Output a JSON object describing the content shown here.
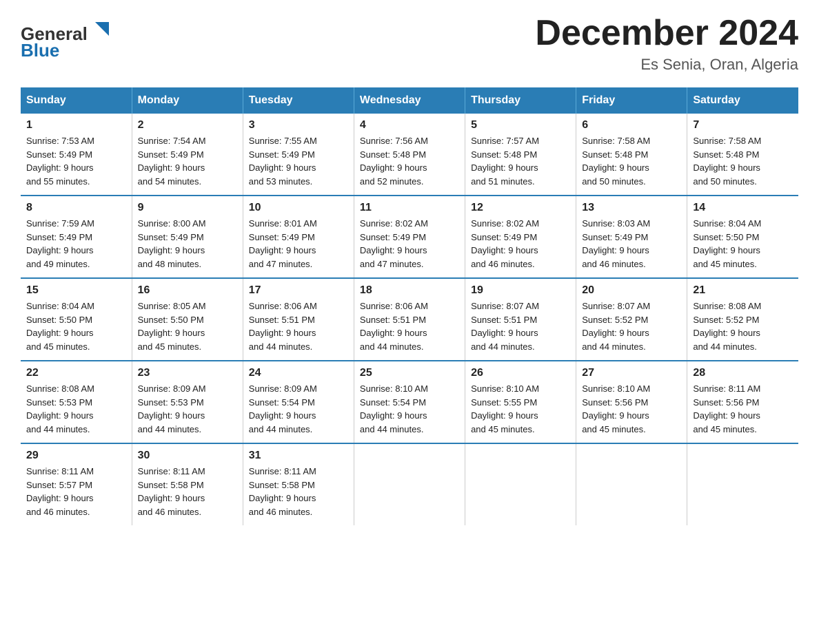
{
  "header": {
    "logo_text_general": "General",
    "logo_text_blue": "Blue",
    "month_title": "December 2024",
    "location": "Es Senia, Oran, Algeria"
  },
  "weekdays": [
    "Sunday",
    "Monday",
    "Tuesday",
    "Wednesday",
    "Thursday",
    "Friday",
    "Saturday"
  ],
  "weeks": [
    [
      {
        "day": "1",
        "sunrise": "7:53 AM",
        "sunset": "5:49 PM",
        "daylight": "9 hours and 55 minutes."
      },
      {
        "day": "2",
        "sunrise": "7:54 AM",
        "sunset": "5:49 PM",
        "daylight": "9 hours and 54 minutes."
      },
      {
        "day": "3",
        "sunrise": "7:55 AM",
        "sunset": "5:49 PM",
        "daylight": "9 hours and 53 minutes."
      },
      {
        "day": "4",
        "sunrise": "7:56 AM",
        "sunset": "5:48 PM",
        "daylight": "9 hours and 52 minutes."
      },
      {
        "day": "5",
        "sunrise": "7:57 AM",
        "sunset": "5:48 PM",
        "daylight": "9 hours and 51 minutes."
      },
      {
        "day": "6",
        "sunrise": "7:58 AM",
        "sunset": "5:48 PM",
        "daylight": "9 hours and 50 minutes."
      },
      {
        "day": "7",
        "sunrise": "7:58 AM",
        "sunset": "5:48 PM",
        "daylight": "9 hours and 50 minutes."
      }
    ],
    [
      {
        "day": "8",
        "sunrise": "7:59 AM",
        "sunset": "5:49 PM",
        "daylight": "9 hours and 49 minutes."
      },
      {
        "day": "9",
        "sunrise": "8:00 AM",
        "sunset": "5:49 PM",
        "daylight": "9 hours and 48 minutes."
      },
      {
        "day": "10",
        "sunrise": "8:01 AM",
        "sunset": "5:49 PM",
        "daylight": "9 hours and 47 minutes."
      },
      {
        "day": "11",
        "sunrise": "8:02 AM",
        "sunset": "5:49 PM",
        "daylight": "9 hours and 47 minutes."
      },
      {
        "day": "12",
        "sunrise": "8:02 AM",
        "sunset": "5:49 PM",
        "daylight": "9 hours and 46 minutes."
      },
      {
        "day": "13",
        "sunrise": "8:03 AM",
        "sunset": "5:49 PM",
        "daylight": "9 hours and 46 minutes."
      },
      {
        "day": "14",
        "sunrise": "8:04 AM",
        "sunset": "5:50 PM",
        "daylight": "9 hours and 45 minutes."
      }
    ],
    [
      {
        "day": "15",
        "sunrise": "8:04 AM",
        "sunset": "5:50 PM",
        "daylight": "9 hours and 45 minutes."
      },
      {
        "day": "16",
        "sunrise": "8:05 AM",
        "sunset": "5:50 PM",
        "daylight": "9 hours and 45 minutes."
      },
      {
        "day": "17",
        "sunrise": "8:06 AM",
        "sunset": "5:51 PM",
        "daylight": "9 hours and 44 minutes."
      },
      {
        "day": "18",
        "sunrise": "8:06 AM",
        "sunset": "5:51 PM",
        "daylight": "9 hours and 44 minutes."
      },
      {
        "day": "19",
        "sunrise": "8:07 AM",
        "sunset": "5:51 PM",
        "daylight": "9 hours and 44 minutes."
      },
      {
        "day": "20",
        "sunrise": "8:07 AM",
        "sunset": "5:52 PM",
        "daylight": "9 hours and 44 minutes."
      },
      {
        "day": "21",
        "sunrise": "8:08 AM",
        "sunset": "5:52 PM",
        "daylight": "9 hours and 44 minutes."
      }
    ],
    [
      {
        "day": "22",
        "sunrise": "8:08 AM",
        "sunset": "5:53 PM",
        "daylight": "9 hours and 44 minutes."
      },
      {
        "day": "23",
        "sunrise": "8:09 AM",
        "sunset": "5:53 PM",
        "daylight": "9 hours and 44 minutes."
      },
      {
        "day": "24",
        "sunrise": "8:09 AM",
        "sunset": "5:54 PM",
        "daylight": "9 hours and 44 minutes."
      },
      {
        "day": "25",
        "sunrise": "8:10 AM",
        "sunset": "5:54 PM",
        "daylight": "9 hours and 44 minutes."
      },
      {
        "day": "26",
        "sunrise": "8:10 AM",
        "sunset": "5:55 PM",
        "daylight": "9 hours and 45 minutes."
      },
      {
        "day": "27",
        "sunrise": "8:10 AM",
        "sunset": "5:56 PM",
        "daylight": "9 hours and 45 minutes."
      },
      {
        "day": "28",
        "sunrise": "8:11 AM",
        "sunset": "5:56 PM",
        "daylight": "9 hours and 45 minutes."
      }
    ],
    [
      {
        "day": "29",
        "sunrise": "8:11 AM",
        "sunset": "5:57 PM",
        "daylight": "9 hours and 46 minutes."
      },
      {
        "day": "30",
        "sunrise": "8:11 AM",
        "sunset": "5:58 PM",
        "daylight": "9 hours and 46 minutes."
      },
      {
        "day": "31",
        "sunrise": "8:11 AM",
        "sunset": "5:58 PM",
        "daylight": "9 hours and 46 minutes."
      },
      null,
      null,
      null,
      null
    ]
  ],
  "labels": {
    "sunrise": "Sunrise:",
    "sunset": "Sunset:",
    "daylight": "Daylight:"
  }
}
